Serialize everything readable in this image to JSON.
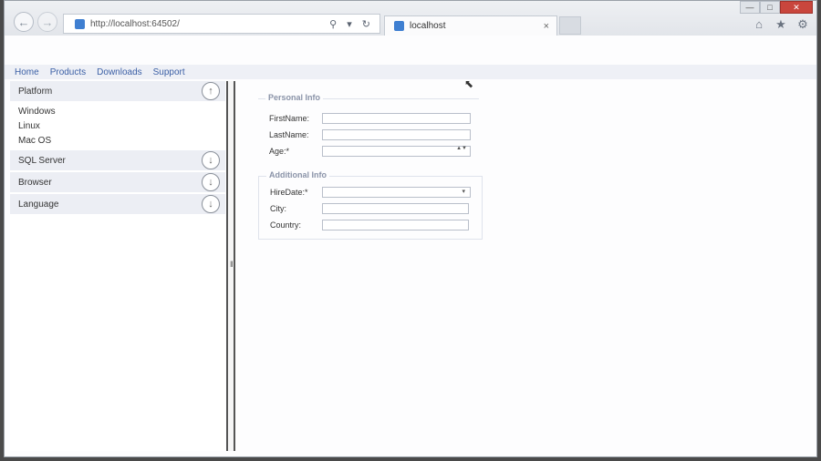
{
  "browser": {
    "url": "http://localhost:64502/",
    "tab_title": "localhost",
    "tab_close": "×",
    "back": "←",
    "forward": "→",
    "address_tools": "⚲ ▾ ↻",
    "window_controls": {
      "minimize": "—",
      "maximize": "□",
      "close": "✕"
    },
    "tools": {
      "home": "⌂",
      "favorites": "★",
      "settings": "⚙"
    }
  },
  "menu": {
    "items": [
      "Home",
      "Products",
      "Downloads",
      "Support"
    ]
  },
  "sidebar": {
    "sections": [
      {
        "title": "Platform",
        "expanded": true,
        "toggle": "↑",
        "items": [
          "Windows",
          "Linux",
          "Mac OS"
        ]
      },
      {
        "title": "SQL Server",
        "expanded": false,
        "toggle": "↓"
      },
      {
        "title": "Browser",
        "expanded": false,
        "toggle": "↓"
      },
      {
        "title": "Language",
        "expanded": false,
        "toggle": "↓"
      }
    ]
  },
  "splitter": {
    "grip": "‖"
  },
  "form": {
    "personal": {
      "legend": "Personal Info",
      "fields": {
        "firstname": {
          "label": "FirstName:",
          "value": ""
        },
        "lastname": {
          "label": "LastName:",
          "value": ""
        },
        "age": {
          "label": "Age:*",
          "value": "",
          "spin": "▲▼"
        }
      }
    },
    "additional": {
      "legend": "Additional Info",
      "fields": {
        "hiredate": {
          "label": "HireDate:*",
          "value": "",
          "caret": "▾"
        },
        "city": {
          "label": "City:",
          "value": ""
        },
        "country": {
          "label": "Country:",
          "value": ""
        }
      }
    }
  },
  "cursor": "⬉",
  "colors": {
    "accent": "#3b5fa5",
    "panel_header": "#eceef4",
    "close_button": "#c9463d"
  }
}
